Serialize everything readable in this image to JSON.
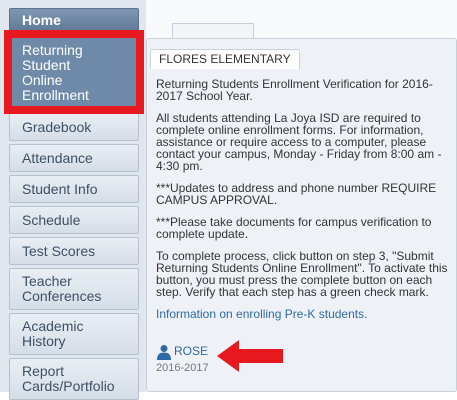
{
  "sidebar": {
    "items": [
      {
        "label": "Home"
      },
      {
        "label": "Returning Student Online Enrollment"
      },
      {
        "label": "Gradebook"
      },
      {
        "label": "Attendance"
      },
      {
        "label": "Student Info"
      },
      {
        "label": "Schedule"
      },
      {
        "label": "Test Scores"
      },
      {
        "label": "Teacher Conferences"
      },
      {
        "label": "Academic History"
      },
      {
        "label": "Report Cards/Portfolio"
      }
    ]
  },
  "panel": {
    "school_tab": "FLORES ELEMENTARY",
    "paragraphs": [
      "Returning Students Enrollment Verification for 2016-2017 School Year.",
      "All students attending La Joya ISD are required to complete online enrollment forms. For information, assistance or require access to a computer, please contact your campus, Monday - Friday from 8:00 am - 4:30 pm.",
      "***Updates to address and phone number REQUIRE CAMPUS APPROVAL.",
      "***Please take documents for campus verification to complete update.",
      "To complete process, click button on step 3, \"Submit Returning Students Online Enrollment\". To activate this button, you must press the complete button on each step. Verify that each step has a green check mark."
    ],
    "prek_link": "Information on enrolling Pre-K students.",
    "student": {
      "name": "ROSE",
      "year": "2016-2017",
      "icon": "person-icon"
    }
  },
  "colors": {
    "highlight": "#e8191e",
    "link": "#2f6aa5",
    "nav_selected": "#6f8aa8"
  }
}
